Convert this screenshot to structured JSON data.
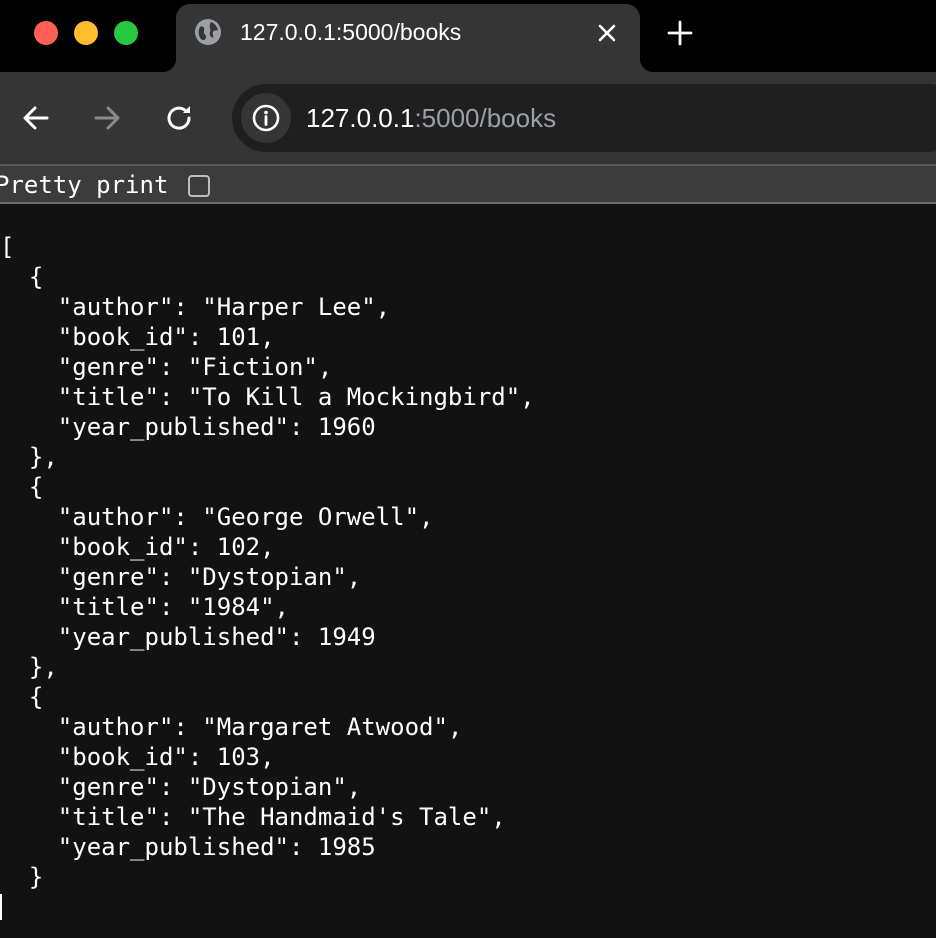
{
  "colors": {
    "traffic_close": "#fe5f57",
    "traffic_minimize": "#febc2e",
    "traffic_maximize": "#28c840",
    "tab_background": "#353535",
    "page_background": "#121212"
  },
  "tab": {
    "favicon": "globe-icon",
    "title": "127.0.0.1:5000/books",
    "close_icon": "close-icon"
  },
  "toolbar": {
    "back_icon": "arrow-left-icon",
    "forward_icon": "arrow-right-icon",
    "reload_icon": "reload-icon",
    "new_tab_icon": "plus-icon",
    "site_info_icon": "info-icon",
    "url_host": "127.0.0.1",
    "url_rest": ":5000/books"
  },
  "pretty_print": {
    "label": "Pretty print",
    "checked": false
  },
  "json_lines": [
    "[",
    "  {",
    "    \"author\": \"Harper Lee\",",
    "    \"book_id\": 101,",
    "    \"genre\": \"Fiction\",",
    "    \"title\": \"To Kill a Mockingbird\",",
    "    \"year_published\": 1960",
    "  },",
    "  {",
    "    \"author\": \"George Orwell\",",
    "    \"book_id\": 102,",
    "    \"genre\": \"Dystopian\",",
    "    \"title\": \"1984\",",
    "    \"year_published\": 1949",
    "  },",
    "  {",
    "    \"author\": \"Margaret Atwood\",",
    "    \"book_id\": 103,",
    "    \"genre\": \"Dystopian\",",
    "    \"title\": \"The Handmaid's Tale\",",
    "    \"year_published\": 1985",
    "  }"
  ]
}
